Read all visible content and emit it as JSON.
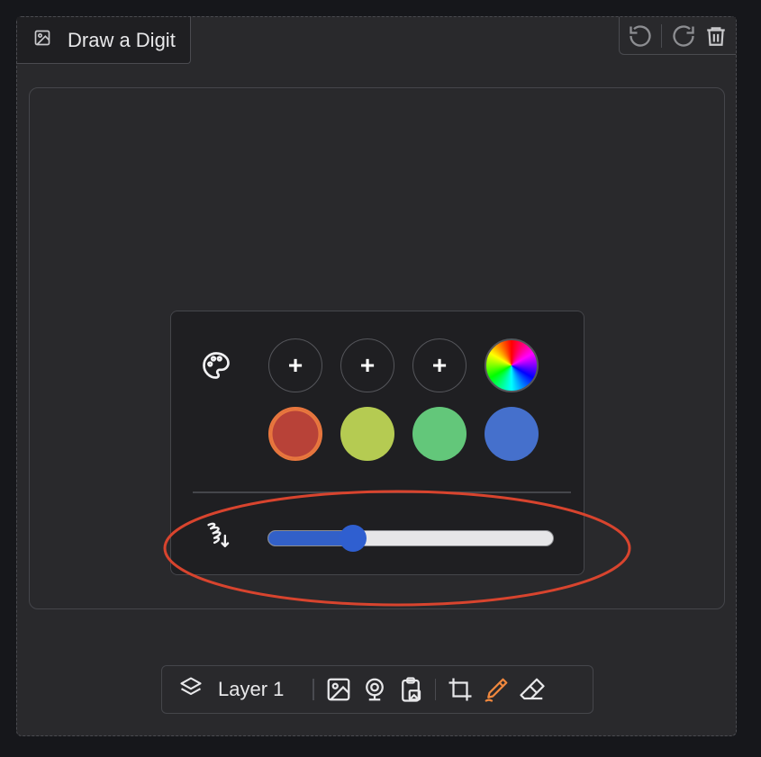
{
  "header": {
    "label": "Draw a Digit",
    "label_icon": "image-icon"
  },
  "history": {
    "undo_icon": "undo-icon",
    "redo_icon": "redo-icon",
    "clear_icon": "trash-icon"
  },
  "brush_popup": {
    "palette_icon": "palette-icon",
    "add_color_symbol": "+",
    "custom_colors": [
      "+",
      "+",
      "+"
    ],
    "preset_colors": [
      "#b84238",
      "#b5cb52",
      "#63c77a",
      "#4570cc"
    ],
    "selected_color": "#b84238",
    "selected_ring_color": "#e8773e",
    "brush_size_icon": "brush-size-icon",
    "brush_size": 0.3
  },
  "annotation": {
    "color": "#d8442e"
  },
  "toolbar": {
    "layer_icon": "layers-icon",
    "layer_label": "Layer 1",
    "tools": [
      "upload-image-icon",
      "webcam-icon",
      "clipboard-icon",
      "crop-icon",
      "brush-icon",
      "eraser-icon"
    ],
    "active_tool": "brush-icon",
    "accent": "#f0883e"
  }
}
